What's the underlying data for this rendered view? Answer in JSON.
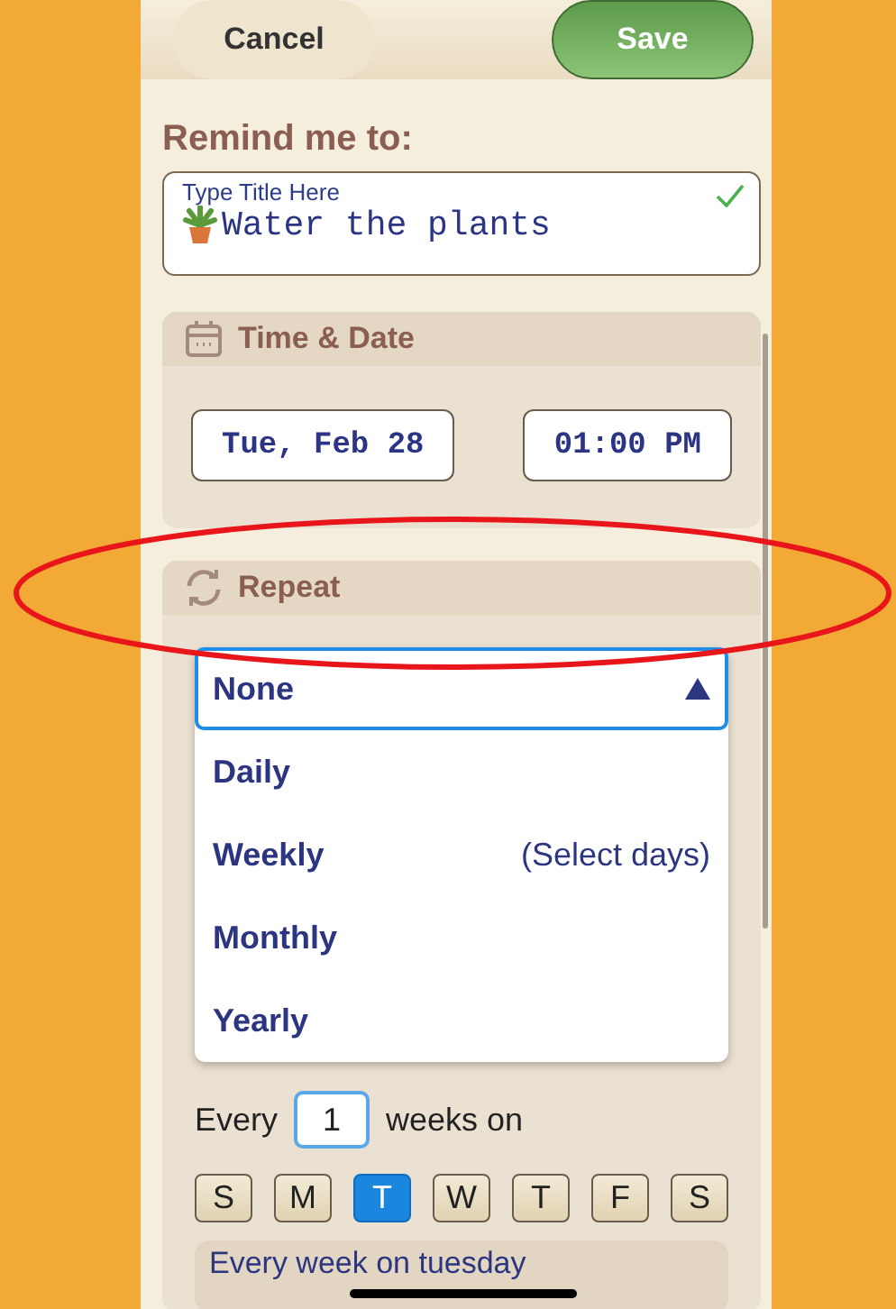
{
  "header": {
    "cancel": "Cancel",
    "save": "Save"
  },
  "reminder": {
    "label": "Remind me to:",
    "placeholder": "Type Title Here",
    "value": "Water the plants",
    "valid": true
  },
  "time_date": {
    "title": "Time & Date",
    "date": "Tue, Feb 28",
    "time": "01:00 PM"
  },
  "repeat": {
    "title": "Repeat",
    "options": [
      {
        "label": "None",
        "selected": true
      },
      {
        "label": "Daily",
        "selected": false
      },
      {
        "label": "Weekly",
        "hint": "(Select days)",
        "selected": false
      },
      {
        "label": "Monthly",
        "selected": false
      },
      {
        "label": "Yearly",
        "selected": false
      }
    ],
    "every_label": "Every",
    "every_value": "1",
    "unit_label": "weeks on",
    "days": [
      {
        "label": "S",
        "selected": false
      },
      {
        "label": "M",
        "selected": false
      },
      {
        "label": "T",
        "selected": true
      },
      {
        "label": "W",
        "selected": false
      },
      {
        "label": "T",
        "selected": false
      },
      {
        "label": "F",
        "selected": false
      },
      {
        "label": "S",
        "selected": false
      }
    ],
    "summary": "Every week on tuesday"
  }
}
